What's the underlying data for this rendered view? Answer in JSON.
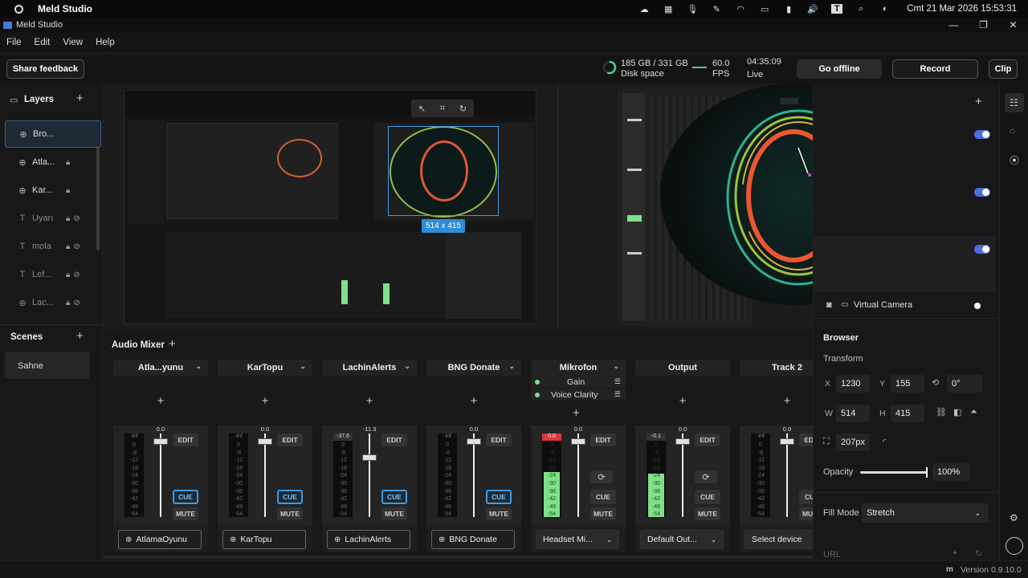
{
  "system": {
    "app_name": "Meld Studio",
    "clock": "Cmt 21 Mar 2026 15:53:31",
    "tray_icons": [
      "cloud-icon",
      "sound-meter-icon",
      "mic-icon",
      "pen-icon",
      "wifi-icon",
      "monitor-icon",
      "battery-icon",
      "volume-icon",
      "text-icon",
      "search-icon",
      "settings-toggle-icon"
    ]
  },
  "window": {
    "title": "Meld Studio",
    "controls": [
      "minimize",
      "maximize",
      "close"
    ]
  },
  "menu": {
    "items": [
      "File",
      "Edit",
      "View",
      "Help"
    ]
  },
  "toolbar": {
    "share_feedback": "Share feedback",
    "disk": "185 GB / 331 GB",
    "disk_label": "Disk space",
    "fps": "60.0",
    "fps_label": "FPS",
    "live_time": "04:35:09",
    "live_label": "Live",
    "go_offline": "Go offline",
    "record": "Record",
    "clip": "Clip"
  },
  "layers": {
    "title": "Layers",
    "items": [
      {
        "label": "Bro...",
        "icon": "globe-icon",
        "state": ""
      },
      {
        "label": "Atla...",
        "icon": "globe-icon",
        "state": "lock"
      },
      {
        "label": "Kar...",
        "icon": "globe-icon",
        "state": "lock"
      },
      {
        "label": "Uyarı",
        "icon": "text-icon",
        "state": "lock hidden"
      },
      {
        "label": "mola",
        "icon": "text-icon",
        "state": "lock hidden"
      },
      {
        "label": "Lef...",
        "icon": "text-icon",
        "state": "lock hidden"
      },
      {
        "label": "Lac...",
        "icon": "globe-icon",
        "state": "lock hidden"
      }
    ]
  },
  "scenes": {
    "title": "Scenes",
    "items": [
      "Sahne"
    ]
  },
  "preview": {
    "selection_size": "514 x 415"
  },
  "mixer": {
    "title": "Audio Mixer",
    "strips": [
      {
        "name": "Atla...yunu",
        "peak": "-inf",
        "fader": "0.0",
        "device": "AtlamaOyunu",
        "cue_active": true
      },
      {
        "name": "KarTopu",
        "peak": "-inf",
        "fader": "0.0",
        "device": "KarTopu",
        "cue_active": true
      },
      {
        "name": "LachinAlerts",
        "peak": "-37.6",
        "fader": "-11.3",
        "device": "LachinAlerts",
        "cue_active": true
      },
      {
        "name": "BNG Donate",
        "peak": "-inf",
        "fader": "0.0",
        "device": "BNG Donate",
        "cue_active": true
      },
      {
        "name": "Mikrofon",
        "peak": "0.0",
        "fader": "0.0",
        "device": "Headset Mi...",
        "cue_active": false,
        "filters": [
          "Gain",
          "Voice Clarity"
        ]
      },
      {
        "name": "Output",
        "peak": "-0.1",
        "fader": "0.0",
        "device": "Default Out...",
        "cue_active": false
      },
      {
        "name": "Track 2",
        "peak": "-inf",
        "fader": "0.0",
        "device": "Select device",
        "cue_active": false
      }
    ],
    "edit": "EDIT",
    "cue": "CUE",
    "mute": "MUTE",
    "scale": "0\n-6\n-12\n-18\n-24\n-30\n-36\n-42\n-48\n-54"
  },
  "inspector": {
    "virtual_camera": "Virtual Camera",
    "section": "Browser",
    "transform": "Transform",
    "x_label": "X",
    "x": "1230",
    "y_label": "Y",
    "y": "155",
    "rotation": "0°",
    "w_label": "W",
    "w": "514",
    "h_label": "H",
    "h": "415",
    "radius": "207px",
    "opacity_label": "Opacity",
    "opacity": "100%",
    "opacity_value": 1.0,
    "fill_mode_label": "Fill Mode",
    "fill_mode": "Stretch",
    "url_label": "URL"
  },
  "footer": {
    "version": "Version 0.9.10.0"
  },
  "colors": {
    "accent": "#3d9be3",
    "toggle": "#4a6ee0",
    "meter_green": "#7fe08a",
    "clip_red": "#e0323c"
  }
}
